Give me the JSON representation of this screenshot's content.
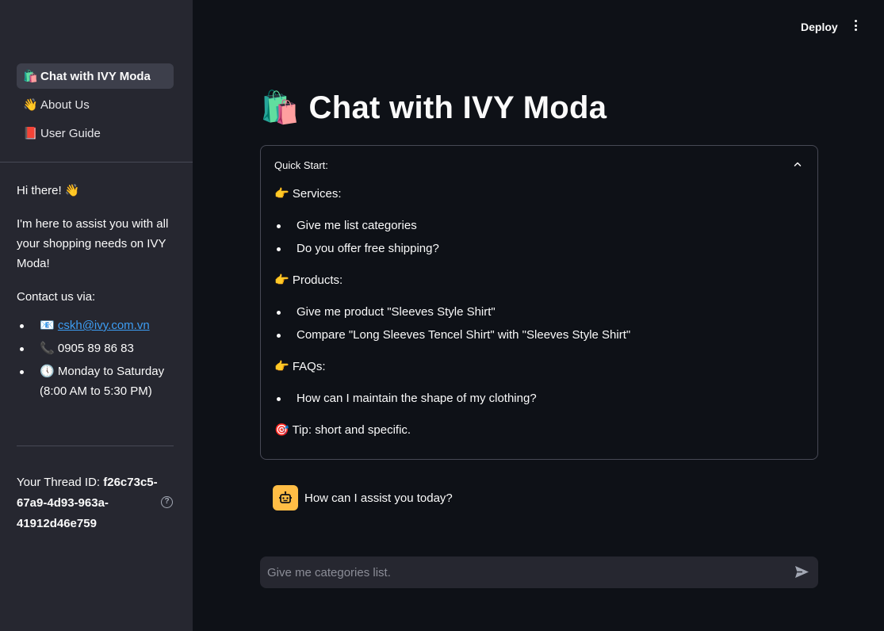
{
  "sidebar": {
    "nav": [
      {
        "emoji": "🛍️",
        "label": "Chat with IVY Moda",
        "active": true
      },
      {
        "emoji": "👋",
        "label": "About Us",
        "active": false
      },
      {
        "emoji": "📕",
        "label": "User Guide",
        "active": false
      }
    ],
    "greeting": "Hi there! 👋",
    "intro": "I'm here to assist you with all your shopping needs on IVY Moda!",
    "contact_heading": "Contact us via:",
    "contacts": {
      "email_icon": "📧",
      "email": "cskh@ivy.com.vn",
      "phone_icon": "📞",
      "phone": "0905 89 86 83",
      "hours_icon": "🕔",
      "hours": "Monday to Saturday (8:00 AM to 5:30 PM)"
    },
    "thread_label": "Your Thread ID:",
    "thread_id": "f26c73c5-67a9-4d93-963a-41912d46e759"
  },
  "header": {
    "deploy_label": "Deploy",
    "menu_icon": "kebab-menu-icon"
  },
  "main": {
    "title_emoji": "🛍️",
    "title": "Chat with IVY Moda",
    "expander": {
      "heading": "Quick Start:",
      "services_heading": "👉 Services:",
      "services": [
        "Give me list categories",
        "Do you offer free shipping?"
      ],
      "products_heading": "👉 Products:",
      "products": [
        "Give me product \"Sleeves Style Shirt\"",
        "Compare \"Long Sleeves Tencel Shirt\" with \"Sleeves Style Shirt\""
      ],
      "faqs_heading": "👉 FAQs:",
      "faqs": [
        "How can I maintain the shape of my clothing?"
      ],
      "tip": "🎯 Tip: short and specific."
    },
    "assistant_message": "How can I assist you today?",
    "chat_input_placeholder": "Give me categories list."
  },
  "colors": {
    "background": "#0e1117",
    "sidebar": "#262730",
    "bot_avatar": "#ffbd45",
    "link": "#3d9df3"
  }
}
